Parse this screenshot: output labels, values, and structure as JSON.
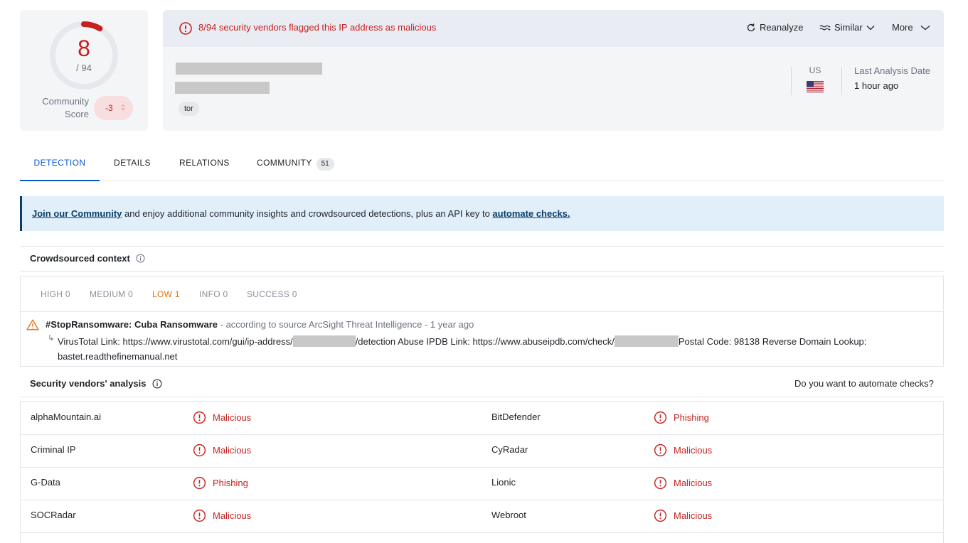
{
  "score": {
    "detections": "8",
    "total": "/ 94",
    "detections_value": 8,
    "total_value": 94,
    "community_label": "Community Score",
    "community_value": "-3"
  },
  "alert": {
    "text": "8/94 security vendors flagged this IP address as malicious",
    "color": "#c5221f"
  },
  "actions": {
    "reanalyze": "Reanalyze",
    "similar": "Similar",
    "more": "More"
  },
  "tags": [
    "tor"
  ],
  "location": {
    "country": "US",
    "last_analysis_label": "Last Analysis Date",
    "last_analysis_value": "1 hour ago"
  },
  "tabs": [
    {
      "label": "DETECTION"
    },
    {
      "label": "DETAILS"
    },
    {
      "label": "RELATIONS"
    },
    {
      "label": "COMMUNITY",
      "badge": "51"
    }
  ],
  "banner": {
    "link1": "Join our Community",
    "middle": " and enjoy additional community insights and crowdsourced detections, plus an API key to ",
    "link2": "automate checks."
  },
  "crowdsourced": {
    "title": "Crowdsourced context",
    "severities": [
      {
        "label": "HIGH 0"
      },
      {
        "label": "MEDIUM 0"
      },
      {
        "label": "LOW 1"
      },
      {
        "label": "INFO 0"
      },
      {
        "label": "SUCCESS 0"
      }
    ],
    "entry": {
      "name": "#StopRansomware: Cuba Ransomware",
      "meta": " - according to source ArcSight Threat Intelligence - 1 year ago",
      "arrow": "↳",
      "detail_part1": "VirusTotal Link: https://www.virustotal.com/gui/ip-address/",
      "detail_part2": "/detection Abuse IPDB Link: https://www.abuseipdb.com/check/",
      "detail_part3": "Postal Code: 98138 Reverse Domain Lookup: bastet.readthefinemanual.net"
    }
  },
  "vendors": {
    "title": "Security vendors' analysis",
    "automate_prompt": "Do you want to automate checks?",
    "rows": [
      {
        "left_name": "alphaMountain.ai",
        "left_result": "Malicious",
        "right_name": "BitDefender",
        "right_result": "Phishing"
      },
      {
        "left_name": "Criminal IP",
        "left_result": "Malicious",
        "right_name": "CyRadar",
        "right_result": "Malicious"
      },
      {
        "left_name": "G-Data",
        "left_result": "Phishing",
        "right_name": "Lionic",
        "right_result": "Malicious"
      },
      {
        "left_name": "SOCRadar",
        "left_result": "Malicious",
        "right_name": "Webroot",
        "right_result": "Malicious"
      }
    ]
  },
  "colors": {
    "malicious": "#c5221f",
    "accent": "#0b57d0",
    "low": "#e8710a"
  }
}
